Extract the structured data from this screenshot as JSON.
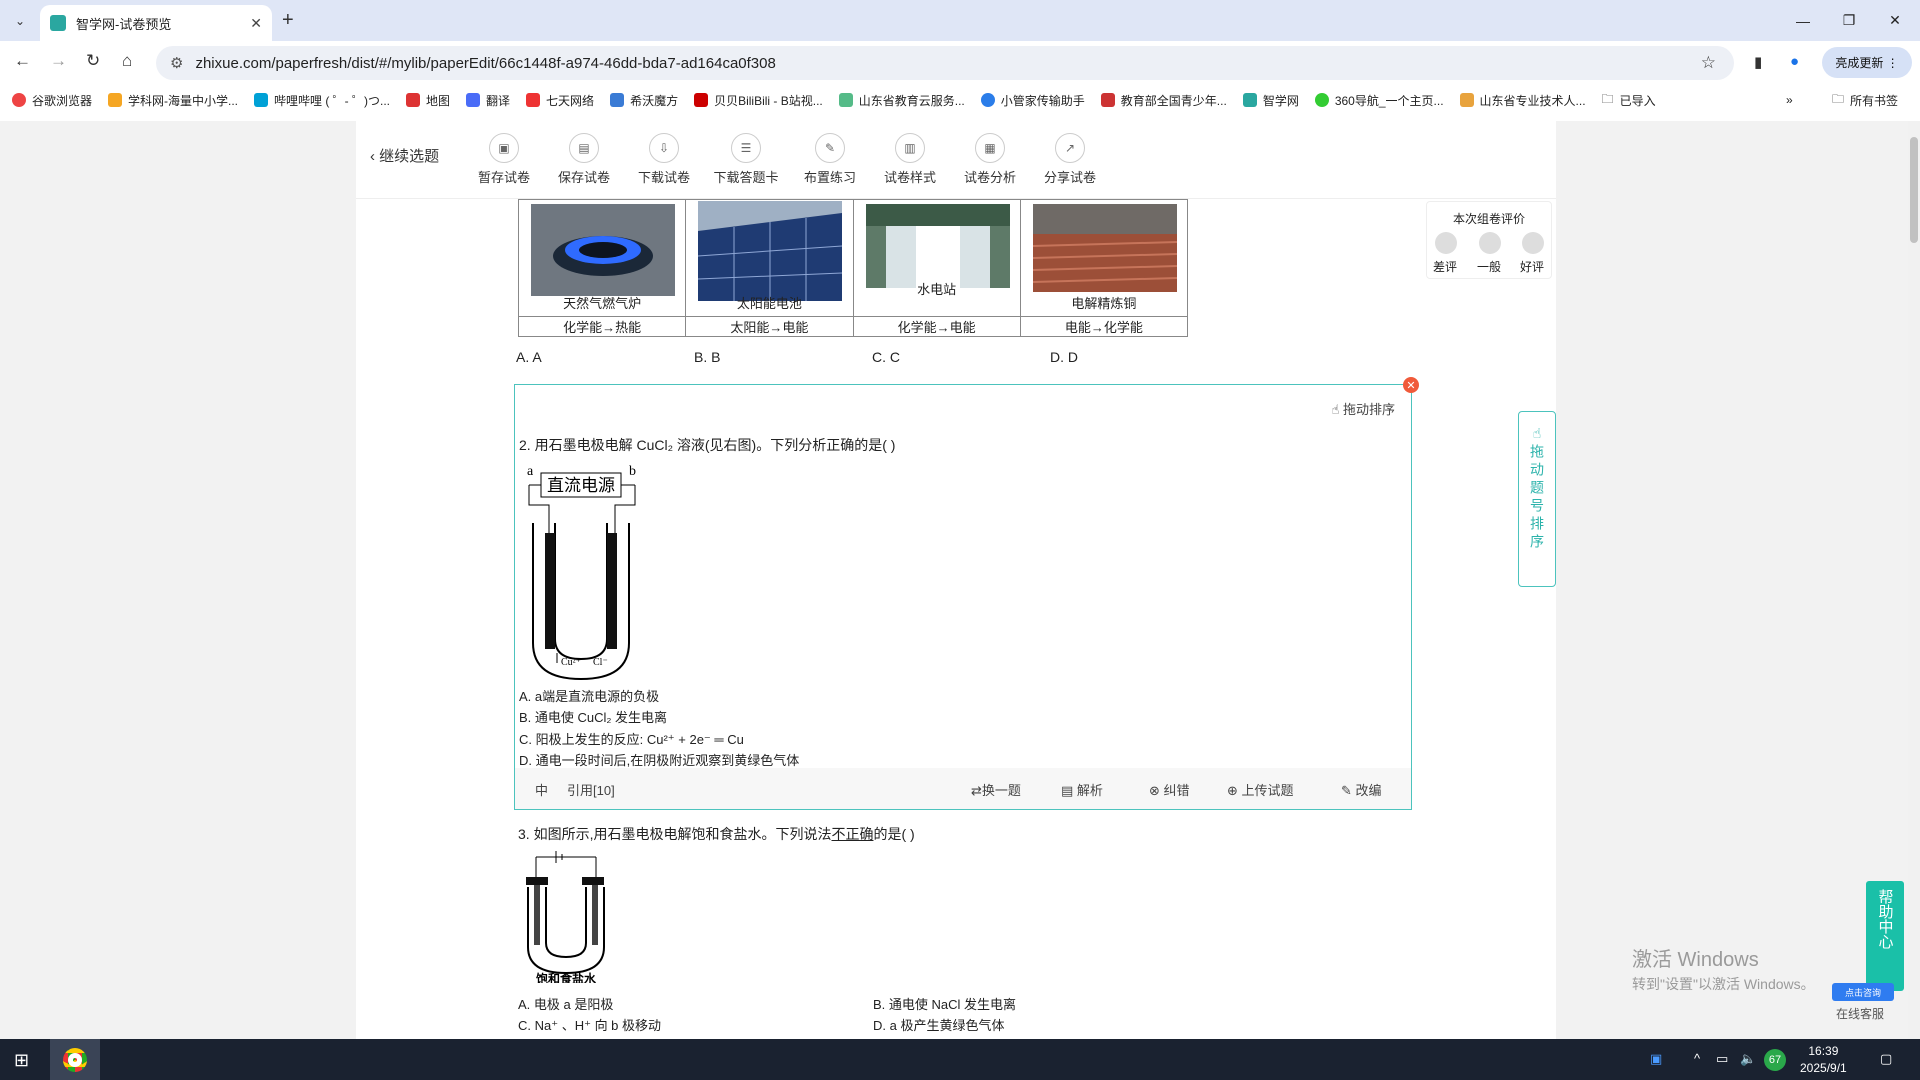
{
  "browser": {
    "tab_title": "智学网-试卷预览",
    "url": "zhixue.com/paperfresh/dist/#/mylib/paperEdit/66c1448f-a974-46dd-bda7-ad164ca0f308",
    "update_label": "亮成更新",
    "bookmarks": [
      "谷歌浏览器",
      "学科网-海量中小学...",
      "哔哩哔哩 ( ゜- ゜)つ...",
      "地图",
      "翻译",
      "七天网络",
      "希沃魔方",
      "贝贝BiliBili - B站视...",
      "山东省教育云服务...",
      "小管家传输助手",
      "教育部全国青少年...",
      "智学网",
      "360导航_一个主页...",
      "山东省专业技术人...",
      "已导入"
    ],
    "bookmarks_more": "»",
    "all_bookmarks": "所有书签"
  },
  "toolbar": {
    "back_label": "继续选题",
    "buttons": [
      "暂存试卷",
      "保存试卷",
      "下载试卷",
      "下载答题卡",
      "布置练习",
      "试卷样式",
      "试卷分析",
      "分享试卷"
    ]
  },
  "q1": {
    "pictures": [
      "天然气燃气炉",
      "太阳能电池",
      "水电站",
      "电解精炼铜"
    ],
    "conversions": [
      "化学能→热能",
      "太阳能→电能",
      "化学能→电能",
      "电能→化学能"
    ],
    "options": [
      "A. A",
      "B. B",
      "C. C",
      "D. D"
    ]
  },
  "q2": {
    "drag_label": "拖动排序",
    "stem": "2. 用石墨电极电解 CuCl₂ 溶液(见右图)。下列分析正确的是(    )",
    "figure_labels": {
      "a": "a",
      "b": "b",
      "source": "直流电源",
      "cu": "Cu²⁺",
      "cl": "Cl⁻"
    },
    "options": [
      "A. a端是直流电源的负极",
      "B. 通电使 CuCl₂ 发生电离",
      "C. 阳极上发生的反应:  Cu²⁺ + 2e⁻ ═ Cu",
      "D. 通电一段时间后,在阴极附近观察到黄绿色气体"
    ],
    "footer": {
      "difficulty": "中",
      "cited": "引用[10]",
      "swap": "换一题",
      "analysis": "解析",
      "correct": "纠错",
      "upload": "上传试题",
      "edit": "改编"
    }
  },
  "q3": {
    "stem_before": "3. 如图所示,用石墨电极电解饱和食盐水。下列说法",
    "stem_underlined": "不正确",
    "stem_after": "的是(    )",
    "figure_caption": "饱和食盐水",
    "options": [
      "A. 电极 a 是阳极",
      "B. 通电使 NaCl 发生电离",
      "C. Na⁺ 、H⁺ 向 b 极移动",
      "D. a 极产生黄绿色气体"
    ]
  },
  "evaluation": {
    "title": "本次组卷评价",
    "bad": "差评",
    "ok": "一般",
    "good": "好评"
  },
  "sort_panel": "拖动题号排序",
  "help": {
    "label": "帮助中心",
    "consult": "点击咨询",
    "online": "在线客服"
  },
  "watermark": {
    "line1": "激活 Windows",
    "line2": "转到\"设置\"以激活 Windows。"
  },
  "taskbar": {
    "time": "16:39",
    "date": "2025/9/1",
    "badge": "67"
  }
}
